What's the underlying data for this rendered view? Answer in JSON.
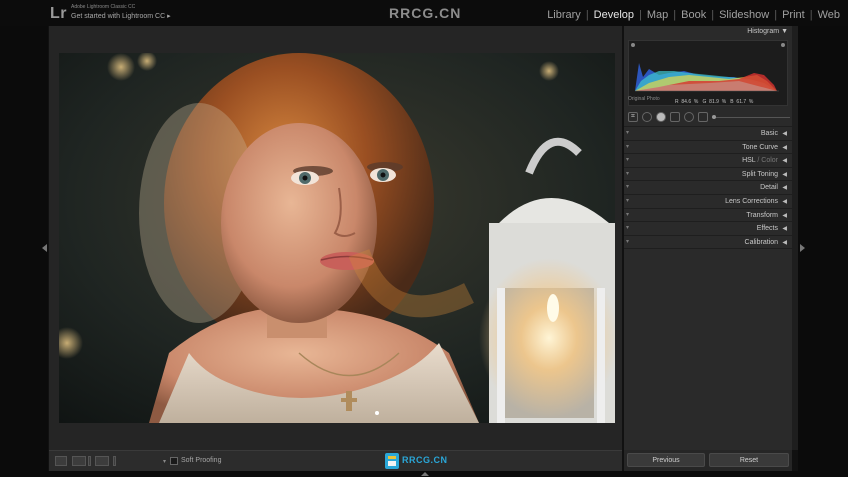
{
  "app": {
    "logo": "Lr",
    "product": "Adobe Lightroom Classic CC",
    "promo": "Get started with Lightroom CC",
    "promo_arrow": "▸"
  },
  "watermark": {
    "top_text": "RRCG.CN",
    "badge_text": "RRCG.CN"
  },
  "modules": [
    {
      "label": "Library",
      "active": false
    },
    {
      "label": "Develop",
      "active": true
    },
    {
      "label": "Map",
      "active": false
    },
    {
      "label": "Book",
      "active": false
    },
    {
      "label": "Slideshow",
      "active": false
    },
    {
      "label": "Print",
      "active": false
    },
    {
      "label": "Web",
      "active": false
    }
  ],
  "module_separator": "|",
  "histogram": {
    "title": "Histogram",
    "menu_glyph": "▼",
    "readout": "R  84.6  %   G  81.9  %   B  61.7  %",
    "original_photo": "Original Photo",
    "colors": {
      "red": "#d8322f",
      "green": "#39b24b",
      "blue": "#2f5fd8",
      "yellow": "#e2d84a",
      "cyan": "#3fc8d0",
      "gray": "#bdbdbd"
    }
  },
  "tools": [
    "crop-overlay",
    "spot-removal",
    "red-eye",
    "graduated-filter",
    "radial-filter",
    "adjustment-brush"
  ],
  "panels": [
    {
      "label": "Basic"
    },
    {
      "label": "Tone Curve"
    },
    {
      "label": "HSL",
      "dim": " / Color"
    },
    {
      "label": "Split Toning"
    },
    {
      "label": "Detail"
    },
    {
      "label": "Lens Corrections"
    },
    {
      "label": "Transform"
    },
    {
      "label": "Effects"
    },
    {
      "label": "Calibration"
    }
  ],
  "panel_tick": "▾",
  "panel_expand_glyph": "◀",
  "toolbar": {
    "soft_proofing": "Soft Proofing",
    "caret": "▾"
  },
  "footer": {
    "previous": "Previous",
    "reset": "Reset"
  }
}
